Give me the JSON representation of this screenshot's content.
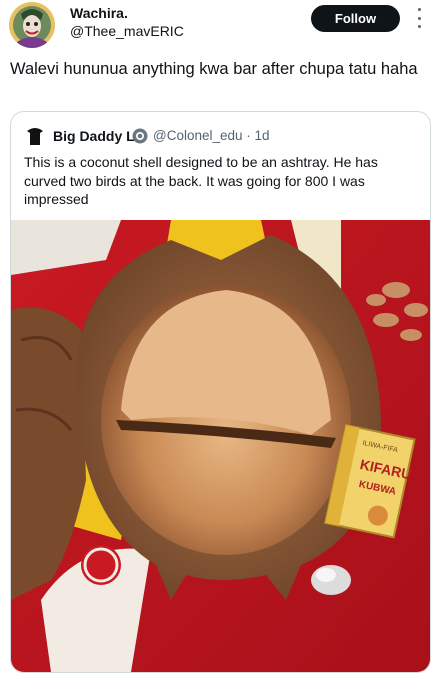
{
  "author": {
    "display_name": "Wachira.",
    "handle": "@Thee_mavERIC",
    "avatar_icon": "joker-avatar"
  },
  "follow_label": "Follow",
  "more_icon": "more-vertical-icon",
  "tweet_text": "Walevi hununua anything kwa bar after chupa tatu haha",
  "quote": {
    "display_name": "Big Daddy L",
    "verified_icon": "verified-icon",
    "handle_time": "@Colonel_edu · 1d",
    "text": "This is a coconut shell designed to be an ashtray. He has curved two birds at the back. It was going for 800 I was impressed",
    "photo_icon": "coconut-ashtray-photo",
    "box_text_top": "ILIWA-FIFA",
    "box_brand": "KIFARU",
    "box_sub": "KUBWA"
  },
  "colors": {
    "follow_bg": "#0f1419",
    "muted": "#536471",
    "border": "#cfd9de"
  }
}
